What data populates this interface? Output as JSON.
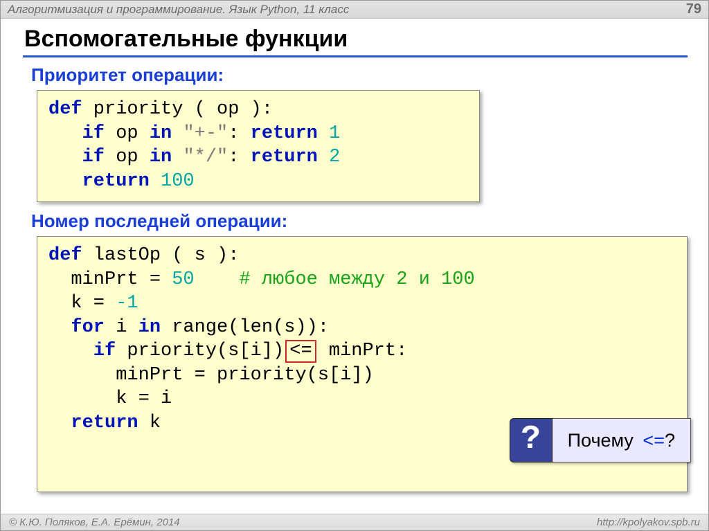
{
  "header": {
    "course": "Алгоритмизация и программирование. Язык Python, 11 класс",
    "page": "79"
  },
  "title": "Вспомогательные функции",
  "section1": {
    "heading": "Приоритет операции:",
    "code": {
      "kw_def": "def",
      "fn": " priority",
      "sig": " ( op ):",
      "l2a": "   ",
      "kw_if1": "if",
      "l2b": " op ",
      "kw_in1": "in",
      "l2c": " ",
      "str1": "\"+-\"",
      "l2d": ": ",
      "kw_ret1": "return",
      "sp1": " ",
      "num1": "1",
      "l3a": "   ",
      "kw_if2": "if",
      "l3b": " op ",
      "kw_in2": "in",
      "l3c": " ",
      "str2": "\"*/\"",
      "l3d": ": ",
      "kw_ret2": "return",
      "sp2": " ",
      "num2": "2",
      "l4a": "   ",
      "kw_ret3": "return",
      "sp3": " ",
      "num3": "100"
    }
  },
  "section2": {
    "heading": "Номер последней операции:",
    "code": {
      "kw_def": "def",
      "fn": " lastOp",
      "sig": " ( s ):",
      "l2a": "  minPrt = ",
      "num50": "50",
      "l2b": "    ",
      "cmt": "# любое между 2 и 100",
      "l3": "  k = ",
      "numm1": "-1",
      "l4a": "  ",
      "kw_for": "for",
      "l4b": " i ",
      "kw_in": "in",
      "l4c": " range(len(s)):",
      "l5a": "    ",
      "kw_if": "if",
      "l5b": " priority(s[i])",
      "boxop": "<=",
      "l5c": " minPrt:",
      "l6": "      minPrt = priority(s[i])",
      "l7": "      k = i",
      "l8a": "  ",
      "kw_ret": "return",
      "l8b": " k"
    }
  },
  "callout": {
    "mark": "?",
    "text": "Почему ",
    "op": "<=",
    "tail": "?"
  },
  "footer": {
    "left": "© К.Ю. Поляков, Е.А. Ерёмин, 2014",
    "right": "http://kpolyakov.spb.ru"
  }
}
